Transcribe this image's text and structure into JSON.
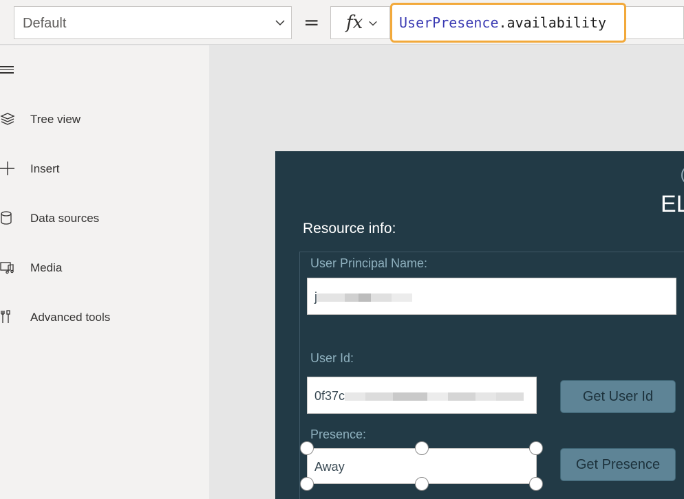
{
  "formula_bar": {
    "property_value": "Default",
    "equals": "=",
    "fx_label": "fx",
    "formula_identifier": "UserPresence",
    "formula_member": ".availability"
  },
  "left_pane": {
    "items": [
      {
        "label": "Tree view",
        "icon": "layers-icon"
      },
      {
        "label": "Insert",
        "icon": "plus-icon"
      },
      {
        "label": "Data sources",
        "icon": "database-icon"
      },
      {
        "label": "Media",
        "icon": "media-icon"
      },
      {
        "label": "Advanced tools",
        "icon": "tools-icon"
      }
    ]
  },
  "app": {
    "logo_text": "EL",
    "section_title": "Resource info:",
    "upn_label": "User Principal Name:",
    "upn_value": "j",
    "userid_label": "User Id:",
    "userid_value": "0f37c",
    "get_user_id_button": "Get User Id",
    "presence_label": "Presence:",
    "presence_value": "Away",
    "get_presence_button": "Get Presence"
  },
  "colors": {
    "formula_highlight": "#f2a93b",
    "app_background": "#223a46",
    "app_button": "#5e8496"
  }
}
